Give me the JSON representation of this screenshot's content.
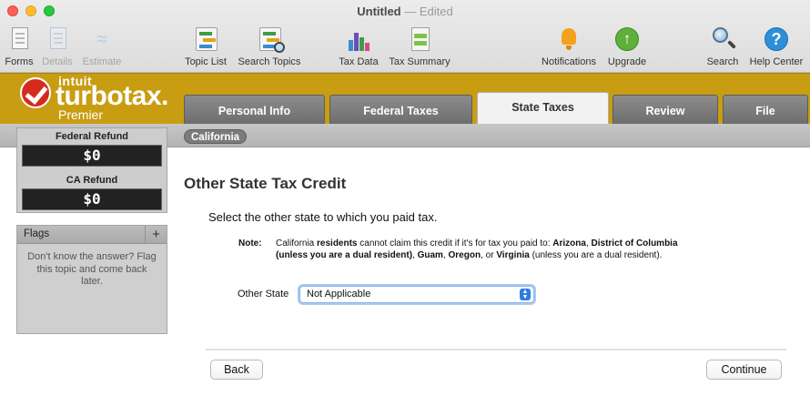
{
  "window": {
    "title": "Untitled",
    "separator": "—",
    "status": "Edited"
  },
  "toolbar": {
    "forms": "Forms",
    "details": "Details",
    "estimate": "Estimate",
    "topic_list": "Topic List",
    "search_topics": "Search Topics",
    "tax_data": "Tax Data",
    "tax_summary": "Tax Summary",
    "notifications": "Notifications",
    "upgrade": "Upgrade",
    "search": "Search",
    "help_center": "Help Center",
    "upgrade_glyph": "↑",
    "help_glyph": "?"
  },
  "brand": {
    "intuit": "intuit",
    "product": "turbotax.",
    "edition": "Premier"
  },
  "tabs": [
    {
      "label": "Personal Info"
    },
    {
      "label": "Federal Taxes"
    },
    {
      "label": "State Taxes"
    },
    {
      "label": "Review"
    },
    {
      "label": "File"
    }
  ],
  "active_tab": "State Taxes",
  "breadcrumb": {
    "state": "California"
  },
  "refunds": {
    "federal_label": "Federal Refund",
    "federal_value": "$0",
    "state_label": "CA Refund",
    "state_value": "$0"
  },
  "flags": {
    "title": "Flags",
    "add": "+",
    "body": "Don't know the answer? Flag this topic and come back later."
  },
  "main": {
    "title": "Other State Tax Credit",
    "instruction": "Select the other state to which you paid tax.",
    "note_label": "Note:",
    "note": {
      "t1": "California ",
      "b1": "residents",
      "t2": " cannot claim this credit if it's for tax you paid to: ",
      "b2": "Arizona",
      "t3": ", ",
      "b3": "District of Columbia (unless you are a dual resident)",
      "t4": ", ",
      "b4": "Guam",
      "t5": ", ",
      "b5": "Oregon",
      "t6": ", or ",
      "b6": "Virginia",
      "t7": " (unless you are a dual resident)."
    },
    "field_label": "Other State",
    "field_value": "Not Applicable"
  },
  "buttons": {
    "back": "Back",
    "continue": "Continue"
  },
  "colors": {
    "brand_bar": "#c99d12",
    "focus_ring": "#a9c9f3",
    "tab": "#7b7b7b"
  }
}
